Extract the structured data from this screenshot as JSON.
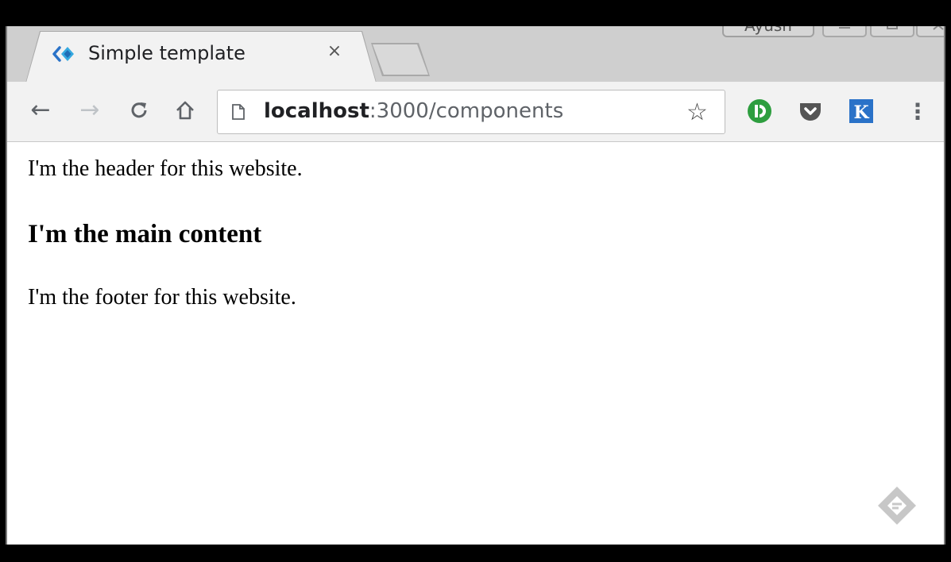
{
  "browser": {
    "tab": {
      "title": "Simple template",
      "close_glyph": "×",
      "favicon": "vue-chevron-icon"
    },
    "profile_name": "Ayush",
    "window_controls": [
      "minimize",
      "maximize",
      "close"
    ],
    "nav": {
      "back": "←",
      "forward": "→",
      "reload": "C",
      "home": "⌂"
    },
    "address": {
      "host": "localhost",
      "rest": ":3000/components"
    },
    "bookmark_glyph": "☆",
    "menu_glyph": "⋮",
    "extensions": [
      "grammarly-icon",
      "pocket-icon",
      "k-extension-icon"
    ]
  },
  "page": {
    "header": "I'm the header for this website.",
    "main_heading": "I'm the main content",
    "footer": "I'm the footer for this website."
  },
  "colors": {
    "tab_bg": "#f2f2f2",
    "strip_bg": "#cfcfcf",
    "accent_green": "#2e9e3f",
    "accent_blue": "#2a72c8"
  }
}
